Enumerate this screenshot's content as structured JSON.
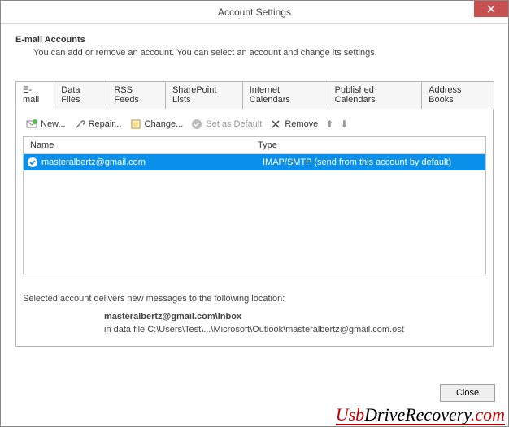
{
  "window": {
    "title": "Account Settings"
  },
  "header": {
    "title": "E-mail Accounts",
    "description": "You can add or remove an account. You can select an account and change its settings."
  },
  "tabs": [
    {
      "label": "E-mail",
      "active": true
    },
    {
      "label": "Data Files",
      "active": false
    },
    {
      "label": "RSS Feeds",
      "active": false
    },
    {
      "label": "SharePoint Lists",
      "active": false
    },
    {
      "label": "Internet Calendars",
      "active": false
    },
    {
      "label": "Published Calendars",
      "active": false
    },
    {
      "label": "Address Books",
      "active": false
    }
  ],
  "toolbar": {
    "new": "New...",
    "repair": "Repair...",
    "change": "Change...",
    "set_default": "Set as Default",
    "remove": "Remove"
  },
  "columns": {
    "name": "Name",
    "type": "Type"
  },
  "accounts": [
    {
      "name": "masteralbertz@gmail.com",
      "type": "IMAP/SMTP (send from this account by default)",
      "selected": true
    }
  ],
  "delivery": {
    "label": "Selected account delivers new messages to the following location:",
    "location": "masteralbertz@gmail.com\\Inbox",
    "datafile": "in data file C:\\Users\\Test\\...\\Microsoft\\Outlook\\masteralbertz@gmail.com.ost"
  },
  "buttons": {
    "close": "Close"
  },
  "watermark": {
    "p1": "Usb",
    "p2": "DriveRecovery",
    "p3": ".com"
  }
}
